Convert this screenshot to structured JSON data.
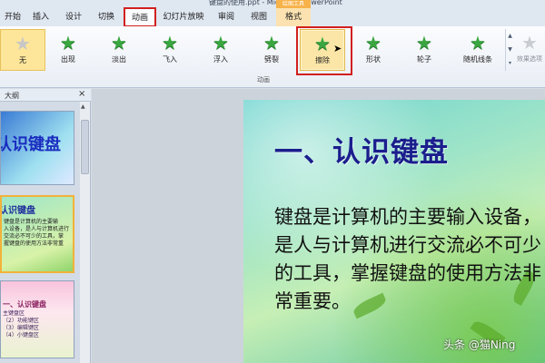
{
  "window": {
    "title": "键盘的使用.ppt - Microsoft PowerPoint",
    "context_tab": "绘图工具"
  },
  "tabs": [
    {
      "label": "开始"
    },
    {
      "label": "插入"
    },
    {
      "label": "设计"
    },
    {
      "label": "切换"
    },
    {
      "label": "动画",
      "active": true,
      "highlighted": true
    },
    {
      "label": "幻灯片放映"
    },
    {
      "label": "审阅"
    },
    {
      "label": "视图"
    },
    {
      "label": "格式",
      "context": true
    }
  ],
  "ribbon": {
    "group_label": "动画",
    "animations": [
      {
        "label": "无",
        "icon": "star-none-icon",
        "state": "selected"
      },
      {
        "label": "出现",
        "icon": "star-appear-icon"
      },
      {
        "label": "淡出",
        "icon": "star-fade-icon"
      },
      {
        "label": "飞入",
        "icon": "star-fly-in-icon"
      },
      {
        "label": "浮入",
        "icon": "star-float-in-icon"
      },
      {
        "label": "劈裂",
        "icon": "star-split-icon"
      },
      {
        "label": "擦除",
        "icon": "star-wipe-icon",
        "state": "hover",
        "highlighted": true
      },
      {
        "label": "形状",
        "icon": "star-shape-icon"
      },
      {
        "label": "轮子",
        "icon": "star-wheel-icon"
      },
      {
        "label": "随机线条",
        "icon": "star-random-bars-icon"
      }
    ],
    "effect_options": {
      "label": "效果选项",
      "enabled": false
    },
    "tooltip": "擦除"
  },
  "outline_panel": {
    "tab_label": "大纲",
    "close": "×",
    "slides": [
      {
        "title": "认识键盘"
      },
      {
        "title": "认识键盘",
        "lines": [
          "键盘是计算机的主要输",
          "入设备，是人与计算机进行",
          "交流必不可少的工具，掌",
          "握键盘的使用方法非常重"
        ]
      },
      {
        "title": "一、认识键盘",
        "lines": [
          "主键盘区",
          "（2）功能键区",
          "（3）编辑键区",
          "（4）小键盘区"
        ]
      }
    ]
  },
  "slide": {
    "title": "一、认识键盘",
    "body": "键盘是计算机的主要输入设备，是人与计算机进行交流必不可少的工具，掌握键盘的使用方法非常重要。"
  },
  "watermark": "头条 @猫Ning",
  "colors": {
    "accent_red": "#d2201f",
    "selected_gold": "#fde59a",
    "star_green": "#3aa640",
    "slide_title": "#1b1e8d"
  }
}
